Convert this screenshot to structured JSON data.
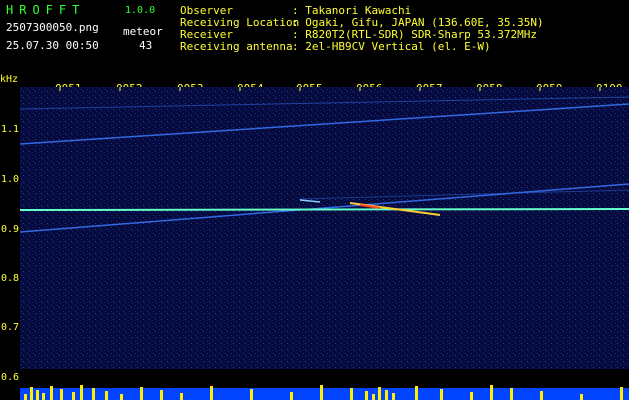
{
  "header": {
    "app_name": "HROFFT",
    "version": "1.0.0",
    "filename": "2507300050.png",
    "datetime": "25.07.30 00:50",
    "count_label": "meteor",
    "count_value": "43",
    "info": [
      {
        "key": "Observer",
        "value": ": Takanori Kawachi"
      },
      {
        "key": "Receiving Location",
        "value": ": Ogaki, Gifu, JAPAN (136.60E, 35.35N)"
      },
      {
        "key": "Receiver",
        "value": ": R820T2(RTL-SDR) SDR-Sharp 53.372MHz"
      },
      {
        "key": "Receiving antenna",
        "value": ": 2el-HB9CV Vertical (el. E-W)"
      }
    ]
  },
  "axis": {
    "unit": "kHz",
    "time_ticks": [
      "0051",
      "0052",
      "0053",
      "0054",
      "0055",
      "0056",
      "0057",
      "0058",
      "0059",
      "0100"
    ],
    "freq_ticks": [
      "1.1",
      "1.0",
      "0.9",
      "0.8",
      "0.7",
      "0.6"
    ]
  },
  "colors": {
    "background": "#050a3a",
    "trace": "#3a7aff",
    "carrier": "#66ffcc",
    "text_green": "#33ff33",
    "text_yellow": "#ffff33"
  }
}
